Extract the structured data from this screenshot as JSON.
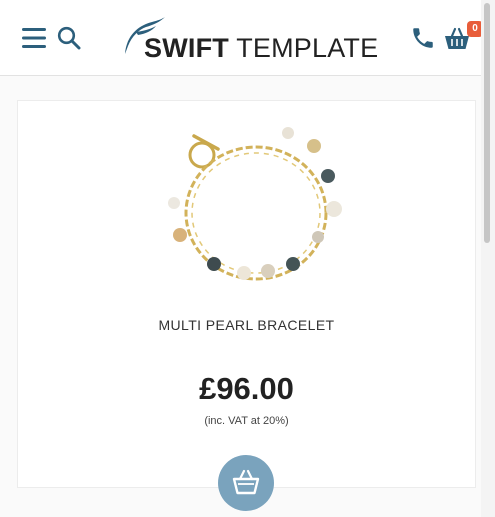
{
  "header": {
    "logo_bold": "SWIFT",
    "logo_light": "TEMPLATE",
    "basket_count": "0"
  },
  "colors": {
    "accent": "#2c5f7c",
    "badge": "#e85d3a",
    "basket_button": "#7aa3bd"
  },
  "icons": {
    "menu": "hamburger-menu-icon",
    "search": "search-icon",
    "phone": "phone-icon",
    "basket": "basket-icon",
    "add_to_basket": "basket-icon"
  },
  "product": {
    "name": "MULTI PEARL BRACELET",
    "price": "£96.00",
    "vat_note": "(inc. VAT at 20%)"
  }
}
